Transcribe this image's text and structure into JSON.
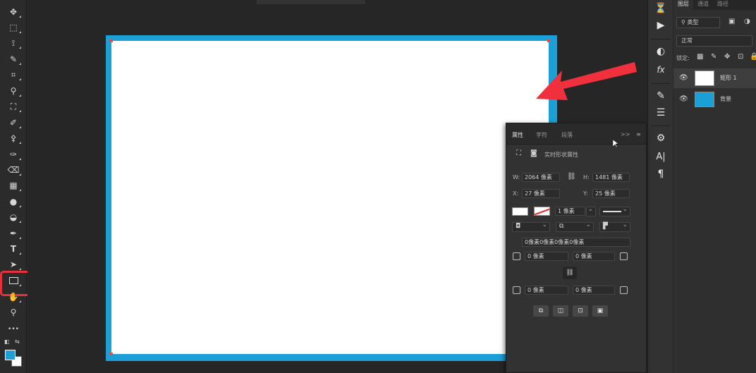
{
  "toolbar": {
    "tools": [
      {
        "name": "move",
        "glyph": "✥"
      },
      {
        "name": "marquee",
        "glyph": "⬚"
      },
      {
        "name": "lasso",
        "glyph": "⟟"
      },
      {
        "name": "quick-select",
        "glyph": "✎"
      },
      {
        "name": "crop",
        "glyph": "⌗"
      },
      {
        "name": "eyedropper",
        "glyph": "⚲"
      },
      {
        "name": "patch",
        "glyph": "⛶"
      },
      {
        "name": "brush",
        "glyph": "✐"
      },
      {
        "name": "stamp",
        "glyph": "⚴"
      },
      {
        "name": "history-brush",
        "glyph": "✑"
      },
      {
        "name": "eraser",
        "glyph": "⌫"
      },
      {
        "name": "gradient",
        "glyph": "▦"
      },
      {
        "name": "blur",
        "glyph": "●"
      },
      {
        "name": "dodge",
        "glyph": "◒"
      },
      {
        "name": "pen",
        "glyph": "✒"
      },
      {
        "name": "type",
        "glyph": "T"
      },
      {
        "name": "path-select",
        "glyph": "➤"
      }
    ],
    "rect_tool": "rectangle-tool",
    "hand_glyph": "✋",
    "zoom_glyph": "⚲",
    "more_glyph": "•••",
    "fg_color": "#1e9fd6",
    "bg_color": "#ffffff"
  },
  "canvas": {
    "border_color": "#1aa0d6",
    "fill_color": "#ffffff",
    "arrow_color": "#f0303c"
  },
  "rightcol": {
    "icons": [
      "history-icon",
      "play-icon",
      "adjust-icon",
      "fx-icon",
      "brush-settings-icon",
      "sliders-icon",
      "properties-icon",
      "character-icon",
      "paragraph-icon"
    ],
    "fx_label": "fx",
    "char_label": "A|",
    "para_label": "¶"
  },
  "layers": {
    "tabs": [
      "图层",
      "通道",
      "路径"
    ],
    "filter_label": "类型",
    "blend_mode": "正常",
    "lock_label": "锁定:",
    "items": [
      {
        "name": "矩形 1",
        "selected": true
      },
      {
        "name": "背景",
        "selected": false
      }
    ]
  },
  "properties": {
    "tabs": [
      "属性",
      "字符",
      "段落"
    ],
    "expand_label": ">>",
    "section_title": "实时形状属性",
    "w_label": "W:",
    "w_value": "2064 像素",
    "h_label": "H:",
    "h_value": "1481 像素",
    "x_label": "X:",
    "x_value": "27 像素",
    "y_label": "Y:",
    "y_value": "25 像素",
    "stroke_width": "1 像素",
    "corner_radii_text": "0像素0像素0像素0像素",
    "corner_tl": "0 像素",
    "corner_tr": "0 像素",
    "corner_bl": "0 像素",
    "corner_br": "0 像素"
  }
}
